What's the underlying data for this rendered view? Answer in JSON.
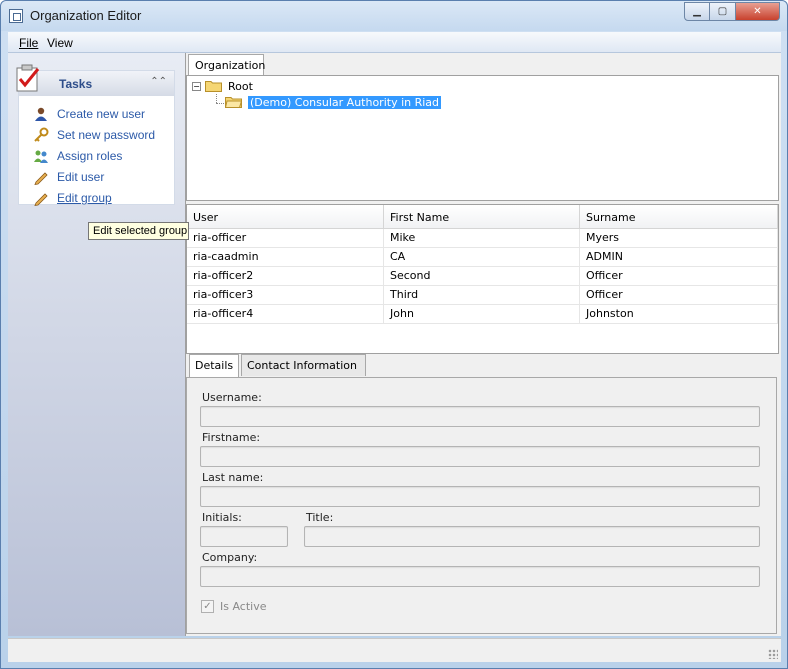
{
  "window": {
    "title": "Organization Editor"
  },
  "menu": {
    "file": "File",
    "view": "View"
  },
  "tasks": {
    "title": "Tasks",
    "items": [
      {
        "label": "Create new user",
        "icon": "user-icon"
      },
      {
        "label": "Set new password",
        "icon": "key-icon"
      },
      {
        "label": "Assign roles",
        "icon": "roles-icon"
      },
      {
        "label": "Edit user",
        "icon": "pencil-icon"
      },
      {
        "label": "Edit group",
        "icon": "pencil-icon"
      }
    ]
  },
  "tooltip": "Edit selected group",
  "organization": {
    "tab": "Organization",
    "tree": {
      "root": "Root",
      "child": "(Demo) Consular Authority in Riad"
    }
  },
  "users_grid": {
    "columns": [
      "User",
      "First Name",
      "Surname"
    ],
    "rows": [
      [
        "ria-officer",
        "Mike",
        "Myers"
      ],
      [
        "ria-caadmin",
        "CA",
        "ADMIN"
      ],
      [
        "ria-officer2",
        "Second",
        "Officer"
      ],
      [
        "ria-officer3",
        "Third",
        "Officer"
      ],
      [
        "ria-officer4",
        "John",
        "Johnston"
      ]
    ]
  },
  "details": {
    "tabs": [
      "Details",
      "Contact Information"
    ],
    "fields": {
      "username": "Username:",
      "firstname": "Firstname:",
      "lastname": "Last name:",
      "initials": "Initials:",
      "title": "Title:",
      "company": "Company:"
    },
    "is_active": {
      "label": "Is Active",
      "checked": true
    }
  },
  "colors": {
    "link": "#2c5aa8",
    "selection": "#3399ff",
    "tooltip_bg": "#ffffe1"
  }
}
